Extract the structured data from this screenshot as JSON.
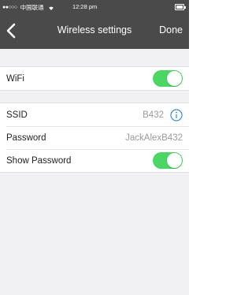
{
  "status_bar": {
    "signal_dots": "●●○○○",
    "carrier": "中国联通",
    "time": "12:28 pm"
  },
  "nav": {
    "title": "Wireless settings",
    "done_label": "Done"
  },
  "wifi": {
    "label": "WiFi",
    "enabled": true
  },
  "network": {
    "ssid_label": "SSID",
    "ssid_value": "B432",
    "password_label": "Password",
    "password_value": "JackAlexB432",
    "show_password_label": "Show Password",
    "show_password_enabled": true
  },
  "colors": {
    "bar_background": "#4a4a4a",
    "toggle_on": "#4cd664",
    "info_accent": "#3b8bd9"
  }
}
